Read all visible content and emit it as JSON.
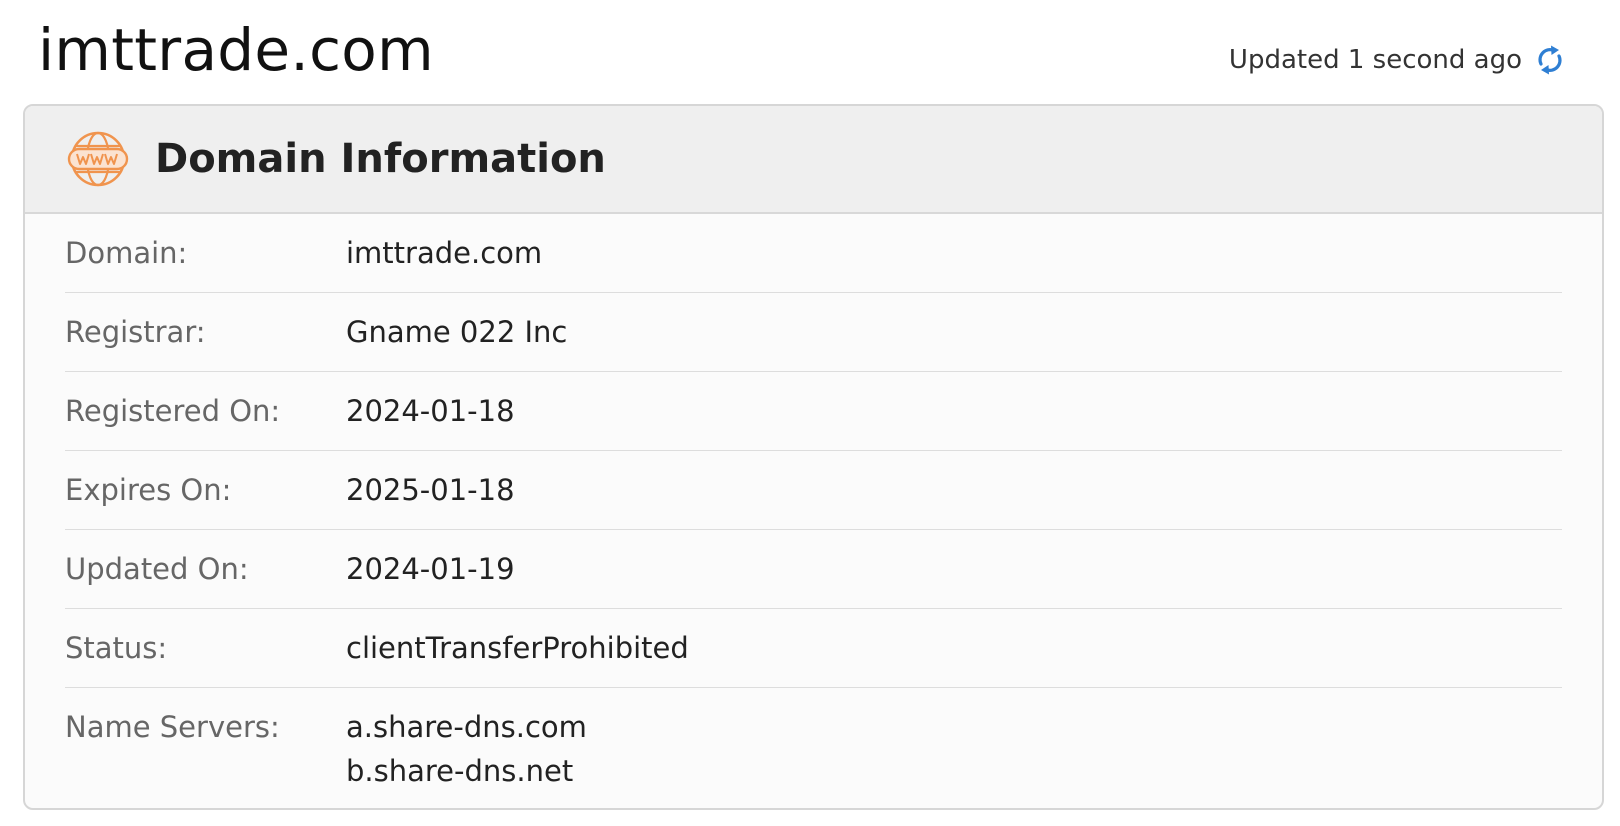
{
  "header": {
    "domain": "imttrade.com",
    "updated_text": "Updated 1 second ago",
    "refresh_icon": "refresh-icon",
    "refresh_color": "#2f7fd3"
  },
  "card": {
    "title": "Domain Information",
    "icon": "www-globe-icon",
    "icon_color": "#f0944e",
    "rows": [
      {
        "label": "Domain:",
        "value": "imttrade.com"
      },
      {
        "label": "Registrar:",
        "value": "Gname 022 Inc"
      },
      {
        "label": "Registered On:",
        "value": "2024-01-18"
      },
      {
        "label": "Expires On:",
        "value": "2025-01-18"
      },
      {
        "label": "Updated On:",
        "value": "2024-01-19"
      },
      {
        "label": "Status:",
        "value": "clientTransferProhibited"
      }
    ],
    "name_servers": {
      "label": "Name Servers:",
      "values": [
        "a.share-dns.com",
        "b.share-dns.net"
      ]
    }
  }
}
